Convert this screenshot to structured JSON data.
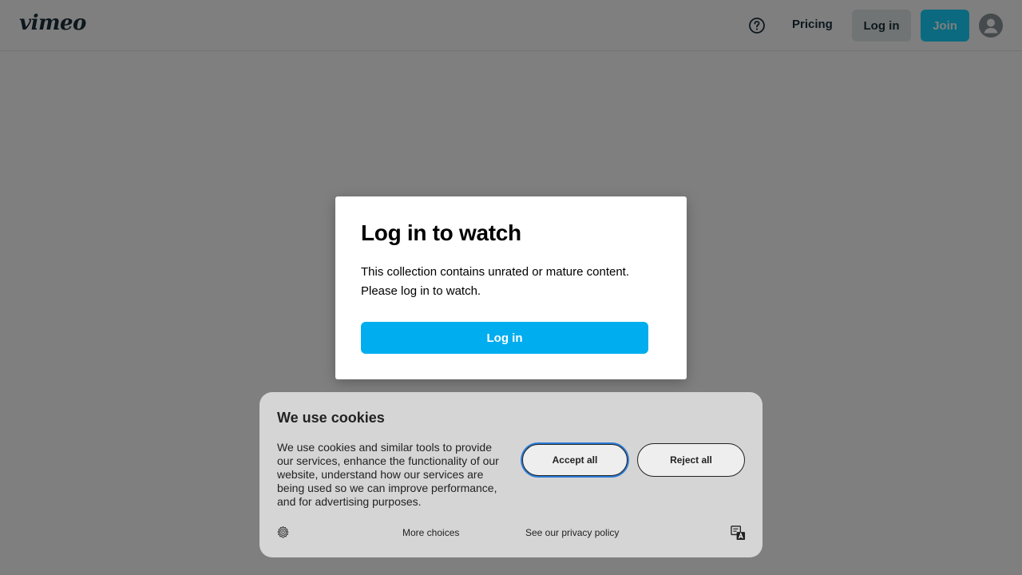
{
  "header": {
    "logo_text": "vimeo",
    "help_icon": "question-circle-icon",
    "pricing_label": "Pricing",
    "login_label": "Log in",
    "join_label": "Join",
    "avatar_icon": "user-avatar-icon"
  },
  "modal": {
    "title": "Log in to watch",
    "body": "This collection contains unrated or mature content. Please log in to watch.",
    "login_label": "Log in"
  },
  "cookie_banner": {
    "title": "We use cookies",
    "text": "We use cookies and similar tools to provide our services, enhance the functionality of our website, understand how our services are being used so we can improve performance, and for advertising purposes.",
    "accept_label": "Accept all",
    "reject_label": "Reject all",
    "settings_icon": "gear-icon",
    "more_choices_label": "More choices",
    "privacy_label": "See our privacy policy",
    "language_icon": "translate-icon"
  },
  "colors": {
    "brand_blue": "#00adef",
    "join_blue": "#17d5ff",
    "focus_ring": "#2d7cd6"
  }
}
